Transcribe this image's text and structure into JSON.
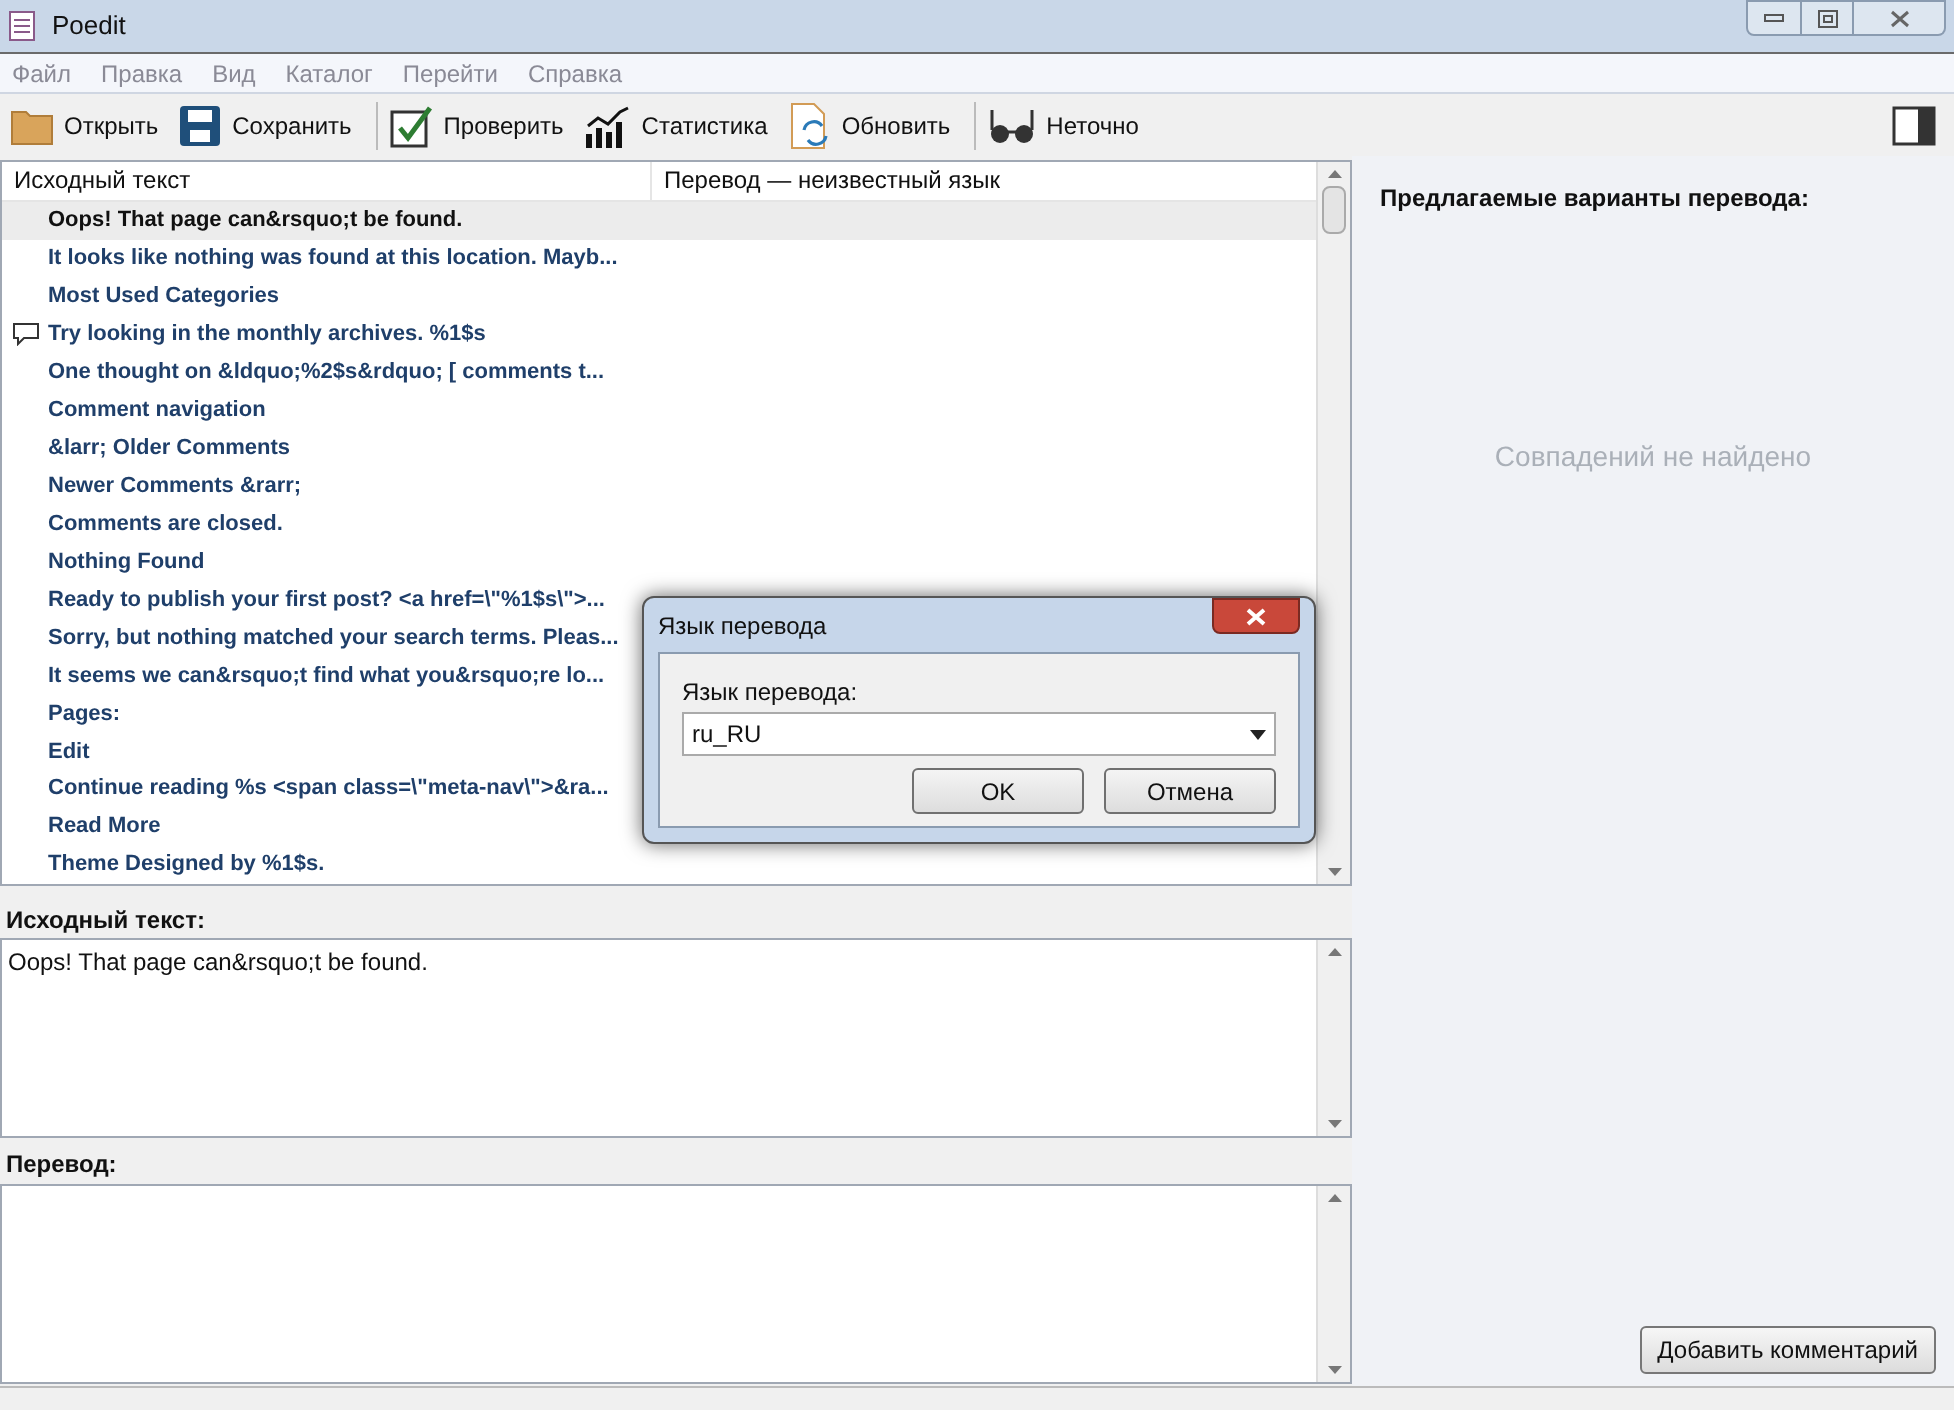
{
  "window": {
    "title": "Poedit"
  },
  "menu": [
    "Файл",
    "Правка",
    "Вид",
    "Каталог",
    "Перейти",
    "Справка"
  ],
  "toolbar": [
    {
      "kind": "open",
      "label": "Открыть"
    },
    {
      "kind": "save",
      "label": "Сохранить"
    },
    {
      "kind": "separator"
    },
    {
      "kind": "check",
      "label": "Проверить"
    },
    {
      "kind": "stats",
      "label": "Статистика"
    },
    {
      "kind": "update",
      "label": "Обновить"
    },
    {
      "kind": "separator"
    },
    {
      "kind": "fuzzy",
      "label": "Неточно"
    }
  ],
  "table": {
    "columns": [
      "Исходный текст",
      "Перевод — неизвестный язык"
    ],
    "rows": [
      {
        "source": "Oops! That page can&rsquo;t be found.",
        "selected": true,
        "comment": false
      },
      {
        "source": "It looks like nothing was found at this location. Mayb...",
        "selected": false,
        "comment": false
      },
      {
        "source": "Most Used Categories",
        "selected": false,
        "comment": false
      },
      {
        "source": "Try looking in the monthly archives. %1$s",
        "selected": false,
        "comment": true
      },
      {
        "source": "One thought on &ldquo;%2$s&rdquo;  [ comments t...",
        "selected": false,
        "comment": false
      },
      {
        "source": "Comment navigation",
        "selected": false,
        "comment": false
      },
      {
        "source": "&larr; Older Comments",
        "selected": false,
        "comment": false
      },
      {
        "source": "Newer Comments &rarr;",
        "selected": false,
        "comment": false
      },
      {
        "source": "Comments are closed.",
        "selected": false,
        "comment": false
      },
      {
        "source": "Nothing Found",
        "selected": false,
        "comment": false
      },
      {
        "source": "Ready to publish your first post? <a href=\\\"%1$s\\\">...",
        "selected": false,
        "comment": false
      },
      {
        "source": "Sorry, but nothing matched your search terms. Pleas...",
        "selected": false,
        "comment": false
      },
      {
        "source": "It seems we can&rsquo;t find what you&rsquo;re lo...",
        "selected": false,
        "comment": false
      },
      {
        "source": "Pages:",
        "selected": false,
        "comment": false
      },
      {
        "source": "Edit",
        "selected": false,
        "comment": false
      },
      {
        "source": "Continue reading %s <span class=\\\"meta-nav\\\">&ra...",
        "selected": false,
        "comment": false
      },
      {
        "source": "Read More",
        "selected": false,
        "comment": false
      },
      {
        "source": "Theme Designed by %1$s.",
        "selected": false,
        "comment": false
      }
    ]
  },
  "source_panel": {
    "label": "Исходный текст:",
    "text": "Oops! That page can&rsquo;t be found."
  },
  "translation_panel": {
    "label": "Перевод:"
  },
  "suggestions": {
    "title": "Предлагаемые варианты перевода:",
    "empty": "Совпадений не найдено",
    "button": "Добавить комментарий"
  },
  "dialog": {
    "title": "Язык перевода",
    "label": "Язык перевода:",
    "value": "ru_RU",
    "buttons": [
      "OK",
      "Отмена"
    ]
  }
}
